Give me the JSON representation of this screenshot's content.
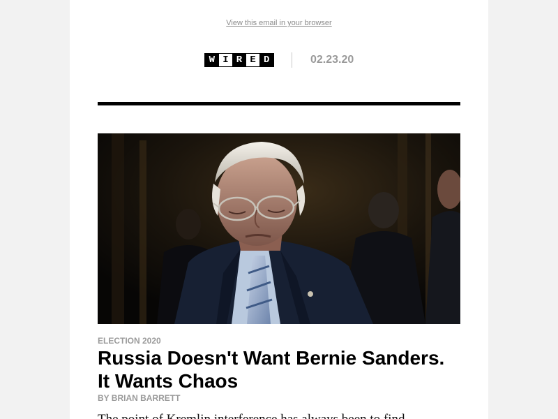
{
  "header": {
    "view_in_browser": "View this email in your browser",
    "logo_text": "WIRED",
    "logo_letters": [
      "W",
      "I",
      "R",
      "E",
      "D"
    ],
    "date": "02.23.20"
  },
  "article": {
    "category": "ELECTION 2020",
    "headline_line1": "Russia Doesn't Want Bernie Sanders.",
    "headline_line2": "It Wants Chaos",
    "byline": "BY BRIAN BARRETT",
    "excerpt_partial": "The point of Kremlin interference has always been to find..."
  },
  "colors": {
    "page_background": "#f2f2f2",
    "email_background": "#ffffff",
    "rule": "#000000",
    "muted_text": "#9a9a9a"
  }
}
